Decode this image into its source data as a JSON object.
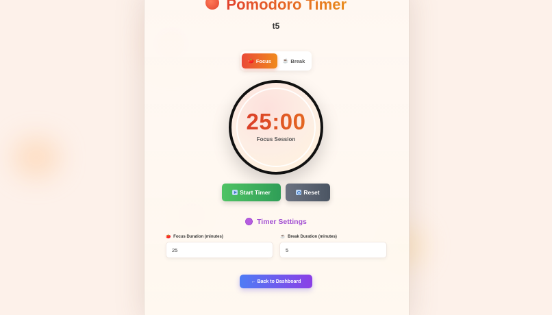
{
  "app": {
    "title": "Pomodoro Timer",
    "title_icon": "tomato-icon",
    "subtitle": "t5"
  },
  "mode_toggle": {
    "focus_label": "Focus",
    "focus_icon": "tomato-icon",
    "break_label": "Break",
    "break_icon": "coffee-icon",
    "selected": "Focus"
  },
  "timer": {
    "time": "25:00",
    "label": "Focus Session"
  },
  "controls": {
    "start_label": "Start Timer",
    "start_icon": "play-icon",
    "reset_label": "Reset",
    "reset_icon": "reset-icon"
  },
  "settings": {
    "title": "Timer Settings",
    "title_icon": "gear-icon",
    "focus_label": "Focus Duration (minutes)",
    "focus_value": "25",
    "break_label": "Break Duration (minutes)",
    "break_value": "5"
  },
  "footer": {
    "back_label": "← Back to Dashboard"
  },
  "colors": {
    "accent_start": "#ea4a38",
    "accent_end": "#f08a1d",
    "start_button": "#3aae5c",
    "reset_button": "#5b626e",
    "settings_title": "#a24fd3",
    "back_button_start": "#4e7cf5",
    "back_button_end": "#8b3fe6"
  }
}
